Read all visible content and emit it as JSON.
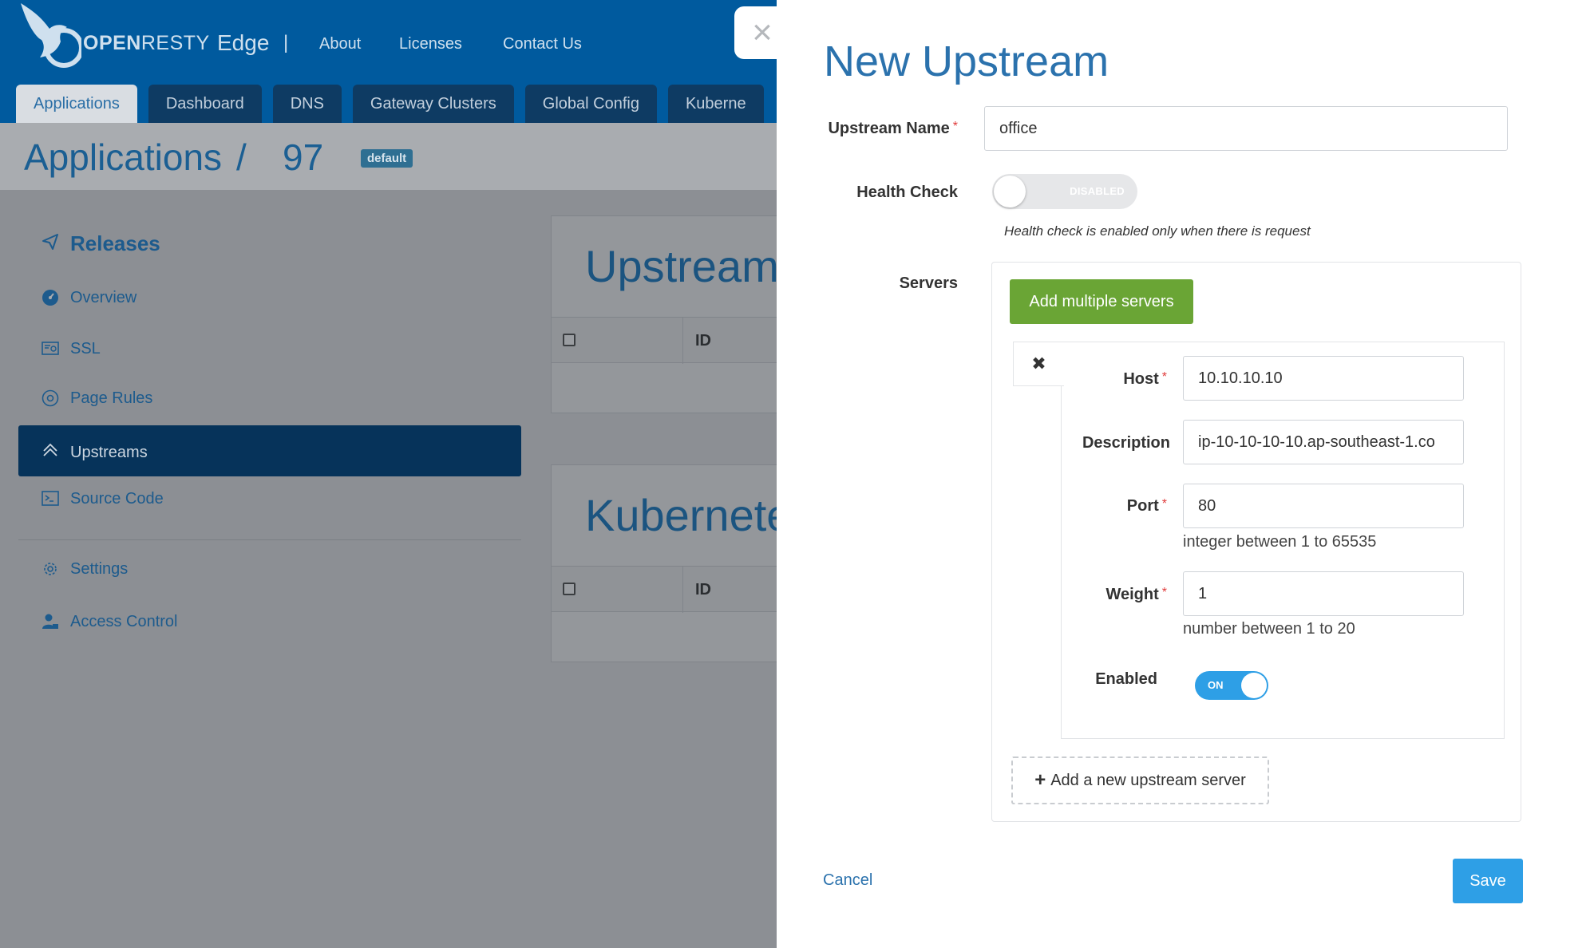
{
  "app": {
    "brand_open": "OPEN",
    "brand_resty": "RESTY",
    "brand_edge": "Edge",
    "separator": "|",
    "top_links": [
      "About",
      "Licenses",
      "Contact Us"
    ],
    "tabs": [
      {
        "label": "Applications",
        "active": true
      },
      {
        "label": "Dashboard",
        "active": false
      },
      {
        "label": "DNS",
        "active": false
      },
      {
        "label": "Gateway Clusters",
        "active": false
      },
      {
        "label": "Global Config",
        "active": false
      },
      {
        "label": "Kuberne",
        "active": false
      }
    ]
  },
  "breadcrumb": {
    "root": "Applications",
    "sep": "/",
    "id": "97",
    "badge": "default"
  },
  "sidebar": {
    "title": "Releases",
    "items": [
      {
        "label": "Overview",
        "icon": "dashboard-icon"
      },
      {
        "label": "SSL",
        "icon": "certificate-icon"
      },
      {
        "label": "Page Rules",
        "icon": "page-rules-icon"
      },
      {
        "label": "Upstreams",
        "icon": "upstreams-icon",
        "active": true
      },
      {
        "label": "Source Code",
        "icon": "terminal-icon"
      },
      {
        "label": "Settings",
        "icon": "gear-icon"
      },
      {
        "label": "Access Control",
        "icon": "user-lock-icon"
      }
    ]
  },
  "panels": [
    {
      "title": "Upstream",
      "col": "ID"
    },
    {
      "title": "Kubernete",
      "col": "ID"
    }
  ],
  "modal": {
    "close_glyph": "×",
    "title": "New Upstream",
    "upstream_name_label": "Upstream Name",
    "upstream_name_value": "office",
    "health_check_label": "Health Check",
    "health_check_state": "DISABLED",
    "health_check_hint": "Health check is enabled only when there is request",
    "servers_label": "Servers",
    "add_multiple_label": "Add multiple servers",
    "remove_glyph": "✖",
    "server": {
      "host_label": "Host",
      "host_value": "10.10.10.10",
      "description_label": "Description",
      "description_value": "ip-10-10-10-10.ap-southeast-1.co",
      "port_label": "Port",
      "port_value": "80",
      "port_help": "integer between 1 to 65535",
      "weight_label": "Weight",
      "weight_value": "1",
      "weight_help": "number between 1 to 20",
      "enabled_label": "Enabled",
      "enabled_state": "ON"
    },
    "add_server_plus": "+",
    "add_server_label": "Add a new upstream server",
    "cancel_label": "Cancel",
    "save_label": "Save",
    "required_mark": "*"
  },
  "colors": {
    "brand_blue": "#005a9e",
    "accent_blue": "#2e9fe6",
    "green": "#6aa535",
    "required_red": "#e03a3a"
  }
}
